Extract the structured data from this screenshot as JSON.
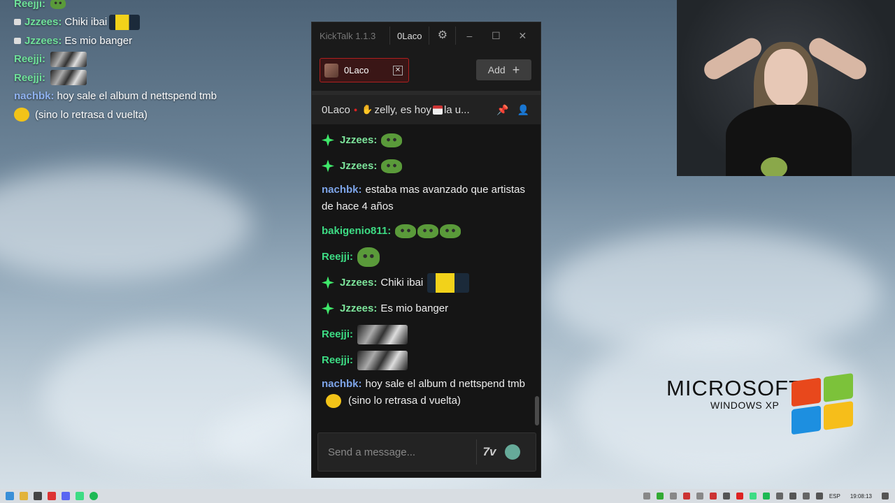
{
  "overlay_chat": [
    {
      "user": "Reejji",
      "sep": ":",
      "text": "",
      "emote": "pepe",
      "badge": false
    },
    {
      "user": "Jzzees",
      "sep": ":",
      "text": "Chiki ibai",
      "emote": "minion",
      "badge": true
    },
    {
      "user": "Jzzees",
      "sep": ":",
      "text": "Es mio banger",
      "emote": "",
      "badge": true
    },
    {
      "user": "Reejji",
      "sep": ":",
      "text": "",
      "emote": "bw",
      "badge": false
    },
    {
      "user": "Reejji",
      "sep": ":",
      "text": "",
      "emote": "bw",
      "badge": false
    },
    {
      "user": "nachbk",
      "sep": ":",
      "text": "hoy sale el album d nettspend tmb",
      "emote": "",
      "badge": false
    },
    {
      "user": "",
      "sep": "",
      "text": "(sino lo retrasa d vuelta)",
      "emote": "yellow",
      "badge": false
    }
  ],
  "kicktalk": {
    "app_title": "KickTalk 1.1.3",
    "user_chip": "0Laco",
    "settings_icon": "gear-icon",
    "tab_label": "0Laco",
    "add_label": "Add",
    "channel_name": "0Laco",
    "pinned_text": "zelly, es hoy",
    "pinned_text_tail": "la u...",
    "input_placeholder": "Send a message...",
    "seven_tv_label": "7v",
    "accent_color": "#3ddc84"
  },
  "chat_messages": [
    {
      "user": "Jzzees",
      "text": "",
      "emote": "pepe",
      "badge": true,
      "cls": "u-jz"
    },
    {
      "user": "Jzzees",
      "text": "",
      "emote": "pepe",
      "badge": true,
      "cls": "u-jz"
    },
    {
      "user": "nachbk",
      "text": "estaba mas avanzado que artistas de hace 4 años",
      "emote": "",
      "badge": false,
      "cls": "u-nach",
      "wrap": true
    },
    {
      "user": "bakigenio811",
      "text": "",
      "emote": "pepe3",
      "badge": false,
      "cls": "u-baki"
    },
    {
      "user": "Reejji",
      "text": "",
      "emote": "pepebig",
      "badge": false,
      "cls": "u-reejji"
    },
    {
      "user": "Jzzees",
      "text": "Chiki ibai",
      "emote": "minion",
      "badge": true,
      "cls": "u-jz"
    },
    {
      "user": "Jzzees",
      "text": "Es mio banger",
      "emote": "",
      "badge": true,
      "cls": "u-jz"
    },
    {
      "user": "Reejji",
      "text": "",
      "emote": "bw",
      "badge": false,
      "cls": "u-reejji"
    },
    {
      "user": "Reejji",
      "text": "",
      "emote": "bw",
      "badge": false,
      "cls": "u-reejji"
    },
    {
      "user": "nachbk",
      "text": "hoy sale el album d nettspend tmb",
      "text2": "(sino lo retrasa d vuelta)",
      "emote": "yellow",
      "badge": false,
      "cls": "u-nach",
      "wrap": true
    }
  ],
  "xp_logo": {
    "line1": "MICROSOFT",
    "line2": "WINDOWS XP"
  },
  "taskbar": {
    "lang": "ESP",
    "clock": "19:08:13"
  }
}
